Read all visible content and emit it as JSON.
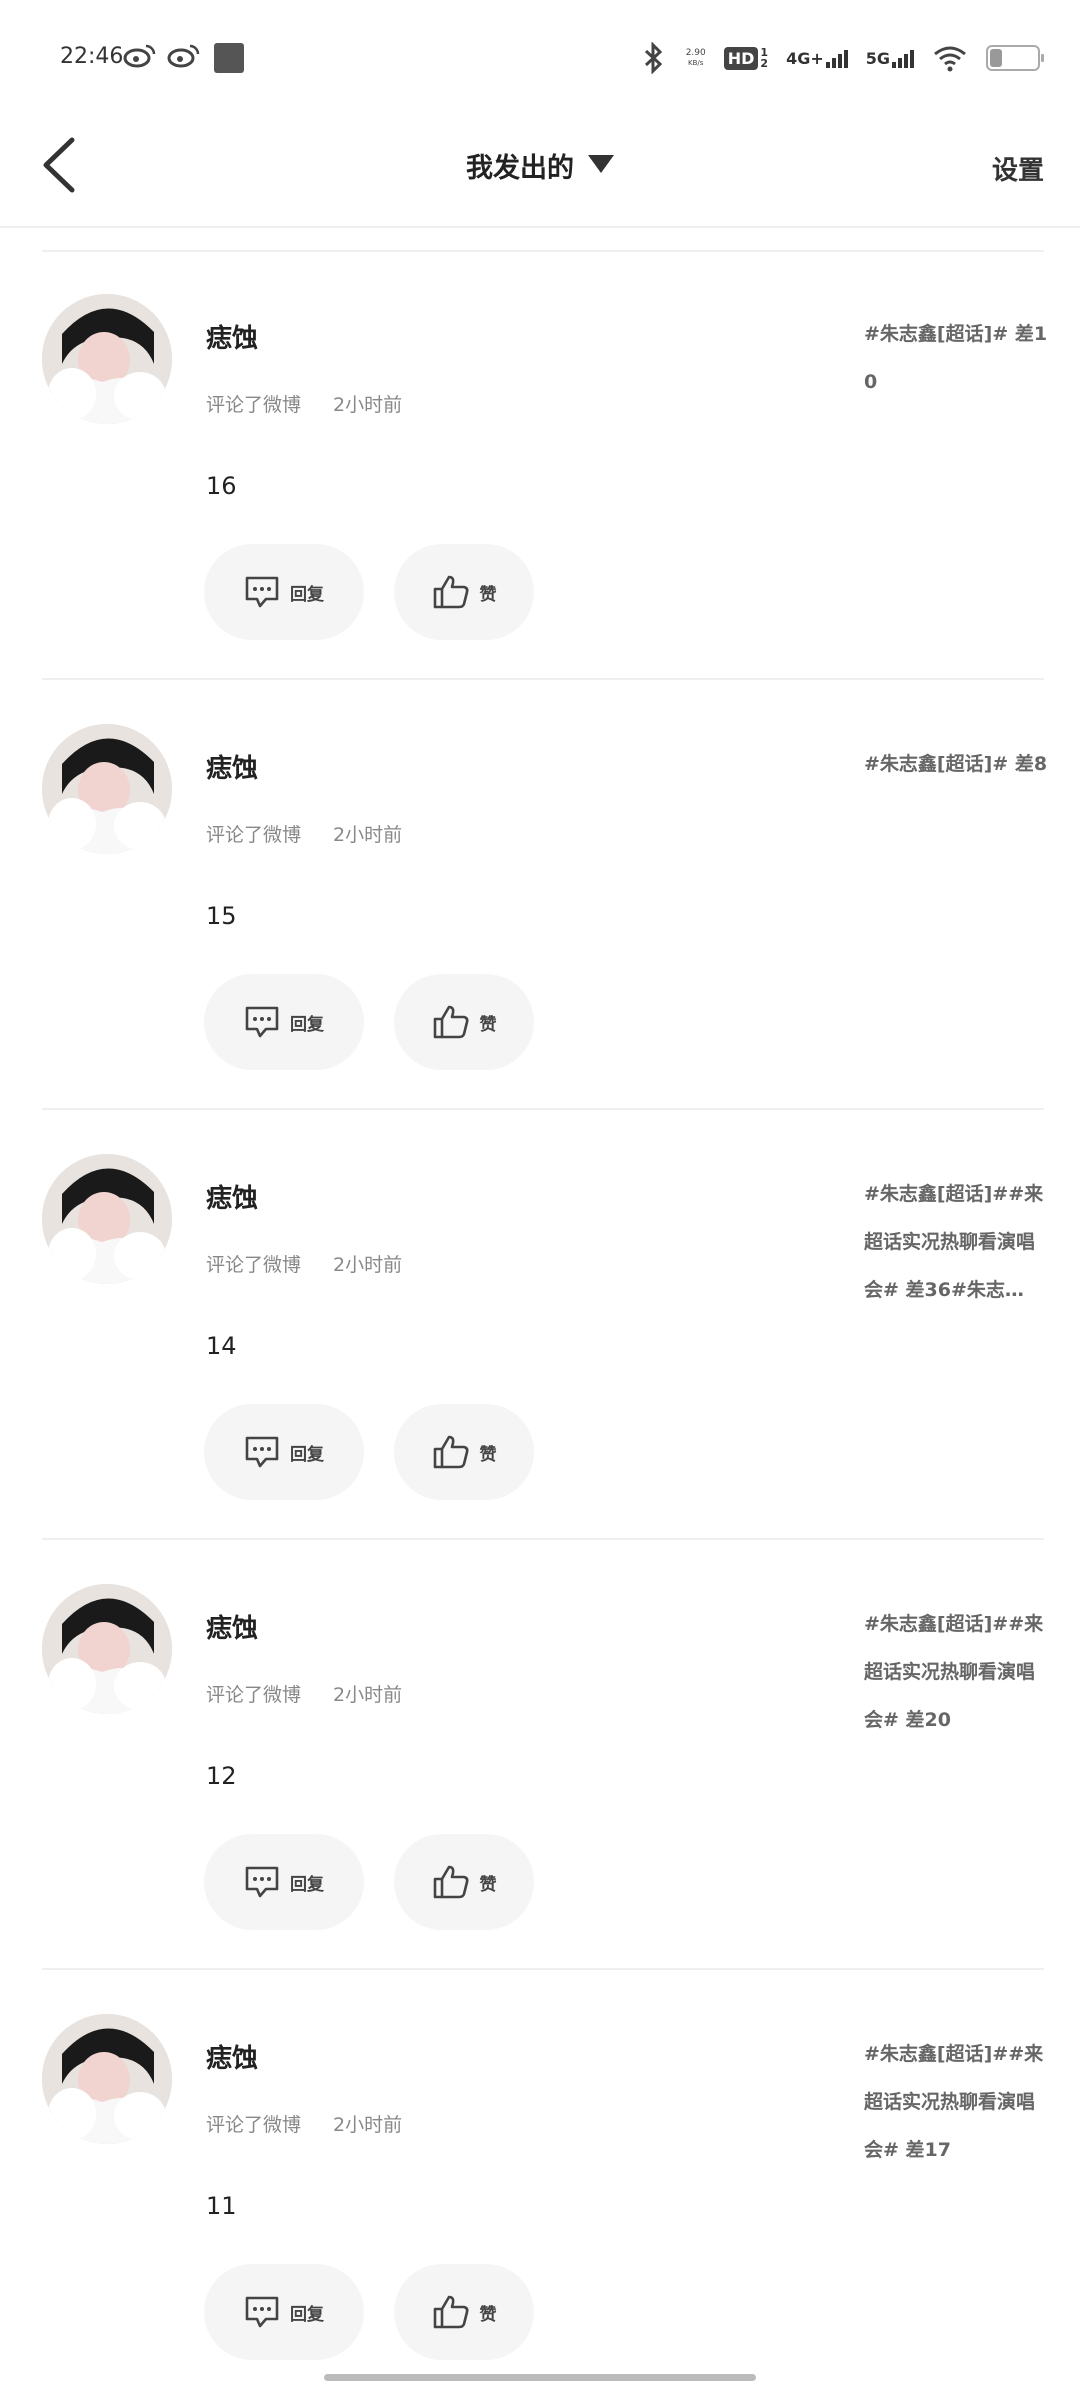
{
  "status_bar": {
    "time": "22:46",
    "net_speed_value": "2.90",
    "net_speed_unit": "KB/s",
    "hd_label": "HD",
    "hd_sub": "1\n2",
    "net_4g": "4G+",
    "net_5g": "5G"
  },
  "header": {
    "title": "我发出的",
    "settings_label": "设置"
  },
  "cards": [
    {
      "name": "痣蚀",
      "action": "评论了微博",
      "time": "2小时前",
      "content": "16",
      "topic": "#朱志鑫[超话]#  差10",
      "reply": "回复",
      "like": "赞"
    },
    {
      "name": "痣蚀",
      "action": "评论了微博",
      "time": "2小时前",
      "content": "15",
      "topic": "#朱志鑫[超话]#  差8",
      "reply": "回复",
      "like": "赞"
    },
    {
      "name": "痣蚀",
      "action": "评论了微博",
      "time": "2小时前",
      "content": "14",
      "topic": "#朱志鑫[超话]##来超话实况热聊看演唱会#  差36#朱志…",
      "reply": "回复",
      "like": "赞"
    },
    {
      "name": "痣蚀",
      "action": "评论了微博",
      "time": "2小时前",
      "content": "12",
      "topic": "#朱志鑫[超话]##来超话实况热聊看演唱会#  差20",
      "reply": "回复",
      "like": "赞"
    },
    {
      "name": "痣蚀",
      "action": "评论了微博",
      "time": "2小时前",
      "content": "11",
      "topic": "#朱志鑫[超话]##来超话实况热聊看演唱会#  差17",
      "reply": "回复",
      "like": "赞"
    }
  ],
  "icons": {
    "back": "chevron-left-icon",
    "dropdown": "caret-down-icon",
    "reply": "comment-icon",
    "like": "thumbs-up-icon"
  }
}
